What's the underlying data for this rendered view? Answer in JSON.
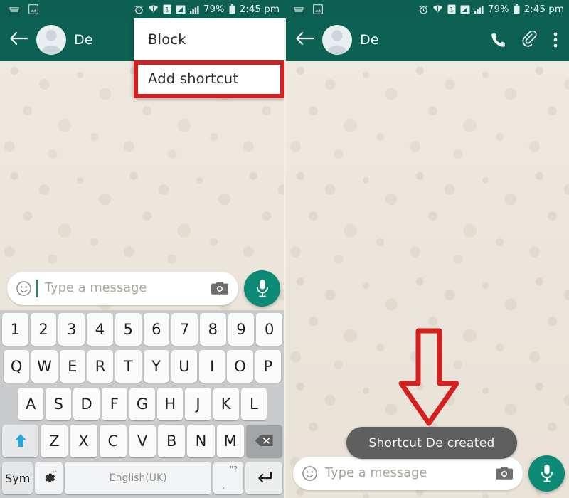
{
  "status_bar": {
    "left_icons": [
      "keyboard-icon",
      "screenshot-image-icon"
    ],
    "alarm_icon": "alarm-clock-icon",
    "wifi_icon": "wifi-icon",
    "sim_label": "1",
    "signal_icons": [
      "signal-bars-icon",
      "signal-bars-icon"
    ],
    "battery_percent": "79%",
    "battery_icon": "battery-icon",
    "time": "2:45 pm"
  },
  "left_panel": {
    "appbar": {
      "back_icon": "back-arrow-icon",
      "avatar_icon": "contact-avatar",
      "contact_name": "De"
    },
    "menu": {
      "items": [
        {
          "label": "Block",
          "highlighted": false
        },
        {
          "label": "Add shortcut",
          "highlighted": true
        }
      ],
      "highlight_color": "#d32020"
    },
    "composer": {
      "emoji_icon": "emoji-smiley-icon",
      "placeholder": "Type a message",
      "camera_icon": "camera-icon",
      "mic_icon": "microphone-icon",
      "mic_color": "#0d8a76"
    },
    "keyboard": {
      "row_numbers": [
        "1",
        "2",
        "3",
        "4",
        "5",
        "6",
        "7",
        "8",
        "9",
        "0"
      ],
      "row_top": [
        "Q",
        "W",
        "E",
        "R",
        "T",
        "Y",
        "U",
        "I",
        "O",
        "P"
      ],
      "row_home": [
        "A",
        "S",
        "D",
        "F",
        "G",
        "H",
        "J",
        "K",
        "L"
      ],
      "row_bottom": [
        "Z",
        "X",
        "C",
        "V",
        "B",
        "N",
        "M"
      ],
      "shift_icon": "shift-arrow-icon",
      "backspace_icon": "backspace-icon",
      "sym_label": "Sym",
      "settings_icon": "gear-icon",
      "space_label": "English(UK)",
      "punct_top": "\"?",
      "punct_bottom": ".",
      "enter_icon": "enter-return-icon"
    }
  },
  "right_panel": {
    "appbar": {
      "back_icon": "back-arrow-icon",
      "avatar_icon": "contact-avatar",
      "contact_name": "De",
      "call_icon": "phone-call-icon",
      "attach_icon": "paperclip-icon",
      "overflow_icon": "three-dot-menu-icon"
    },
    "annotation": {
      "arrow_icon": "down-arrow-annotation",
      "arrow_color": "#d32020"
    },
    "toast": {
      "message": "Shortcut De created",
      "background": "#5e5e5e"
    },
    "composer": {
      "emoji_icon": "emoji-smiley-icon",
      "placeholder": "Type a message",
      "camera_icon": "camera-icon",
      "mic_icon": "microphone-icon",
      "mic_color": "#0d8a76"
    }
  }
}
